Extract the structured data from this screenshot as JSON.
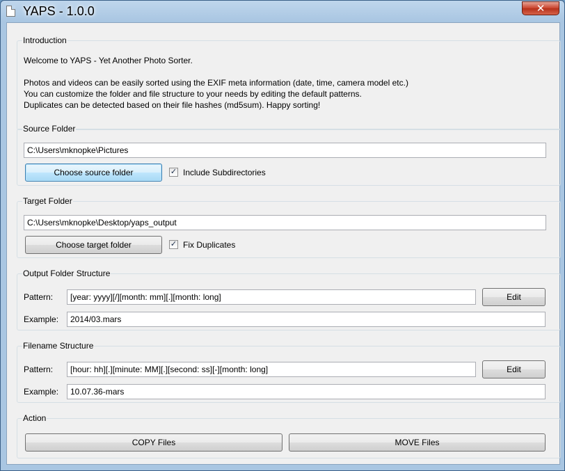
{
  "window": {
    "title": "YAPS - 1.0.0",
    "close_glyph": "✕"
  },
  "intro": {
    "title": "Introduction",
    "line1": "Welcome to YAPS - Yet Another Photo Sorter.",
    "line2": "Photos and videos can be easily sorted using the EXIF meta information (date, time, camera model etc.)",
    "line3": "You can customize the folder and file structure to your needs by editing the default patterns.",
    "line4": "Duplicates can be detected based on their file hashes (md5sum). Happy sorting!"
  },
  "source": {
    "title": "Source Folder",
    "path": "C:\\Users\\mknopke\\Pictures",
    "button": "Choose source folder",
    "checkbox_label": "Include Subdirectories",
    "checked": true
  },
  "target": {
    "title": "Target Folder",
    "path": "C:\\Users\\mknopke\\Desktop/yaps_output",
    "button": "Choose target folder",
    "checkbox_label": "Fix Duplicates",
    "checked": true
  },
  "output_structure": {
    "title": "Output Folder Structure",
    "pattern_label": "Pattern:",
    "pattern": "[year: yyyy][/][month: mm][.][month: long]",
    "edit_button": "Edit",
    "example_label": "Example:",
    "example": "2014/03.mars"
  },
  "filename_structure": {
    "title": "Filename Structure",
    "pattern_label": "Pattern:",
    "pattern": "[hour: hh][.][minute: MM][.][second: ss][-][month: long]",
    "edit_button": "Edit",
    "example_label": "Example:",
    "example": "10.07.36-mars"
  },
  "action": {
    "title": "Action",
    "copy_button": "COPY Files",
    "move_button": "MOVE Files"
  },
  "check_glyph": "✓"
}
